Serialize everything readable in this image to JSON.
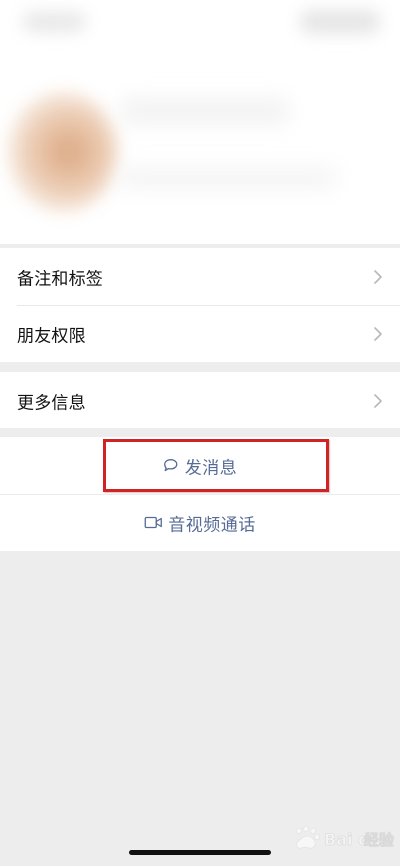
{
  "list": {
    "items": [
      {
        "label": "备注和标签"
      },
      {
        "label": "朋友权限"
      },
      {
        "label": "更多信息"
      }
    ]
  },
  "actions": {
    "message": {
      "label": "发消息",
      "icon": "chat-bubble-icon"
    },
    "call": {
      "label": "音视频通话",
      "icon": "video-camera-icon"
    }
  },
  "watermark": {
    "text": "Baidu经验"
  },
  "colors": {
    "page_background": "#ededed",
    "card_background": "#ffffff",
    "action_text": "#566b95",
    "highlight": "#d02424",
    "chevron": "#b8b8b8"
  }
}
